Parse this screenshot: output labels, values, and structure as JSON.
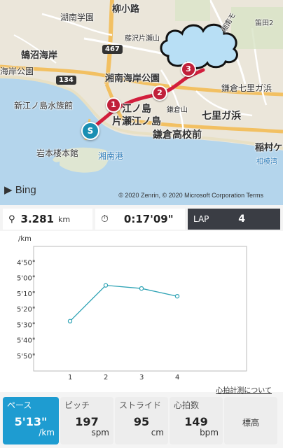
{
  "map": {
    "labels": {
      "yanagi": "柳小路",
      "shonan_gakuen": "湖南学園",
      "fujisawa_katase": "藤沢片瀬山",
      "kugenuma": "鵠沼海岸",
      "kaigan_park_west": "海岸公園",
      "shonan_kaigan_park": "湘南海岸公園",
      "enoshima_aquarium": "新江ノ島水族館",
      "enoshima": "江ノ島",
      "katase_enoshima": "片瀬江ノ島",
      "kamakura_high": "鎌倉高校前",
      "shichirigahama": "七里ガ浜",
      "kamakura_shichirigahama": "鎌倉七里ガ浜",
      "kamakurayama": "鎌倉山",
      "iwamotoro": "岩本楼本館",
      "shonan_port": "湘南港",
      "inamuragasaki": "稲村ケ",
      "sagami": "相模湾",
      "fuedazaka": "笛田2",
      "shonan_mo": "湘南モ"
    },
    "route_shields": {
      "r467": "467",
      "r134": "134"
    },
    "markers": [
      "1",
      "2",
      "3"
    ],
    "start_marker": "S",
    "bing": "Bing",
    "copyright": "© 2020 Zenrin, © 2020 Microsoft Corporation  Terms"
  },
  "stats": {
    "distance_value": "3.281",
    "distance_unit": "km",
    "time_value": "0:17'09\"",
    "lap_label": "LAP",
    "lap_value": "4"
  },
  "chart_data": {
    "type": "line",
    "ylabel": "/km",
    "y_ticks": [
      "4'50\"",
      "5'00\"",
      "5'10\"",
      "5'20\"",
      "5'30\"",
      "5'40\"",
      "5'50\""
    ],
    "y_tick_seconds": [
      290,
      300,
      310,
      320,
      330,
      340,
      350
    ],
    "y_inverted": true,
    "ylim_seconds": [
      280,
      360
    ],
    "x": [
      1,
      2,
      3,
      4
    ],
    "x_labels": [
      "1",
      "2",
      "3",
      "4"
    ],
    "values_seconds": [
      328,
      305,
      307,
      312
    ],
    "color": "#2fa3b5"
  },
  "chart_link": "心拍計測について",
  "tabs": {
    "pace": {
      "label": "ペース",
      "value": "5'13\"",
      "unit": "/km"
    },
    "pitch": {
      "label": "ピッチ",
      "value": "197",
      "unit": "spm"
    },
    "stride": {
      "label": "ストライド",
      "value": "95",
      "unit": "cm"
    },
    "heart": {
      "label": "心拍数",
      "value": "149",
      "unit": "bpm"
    },
    "elevation": {
      "label": "標高"
    }
  },
  "colors": {
    "accent": "#1e9cd1",
    "route": "#d21e3c",
    "lap_bg": "#3a3d44"
  }
}
